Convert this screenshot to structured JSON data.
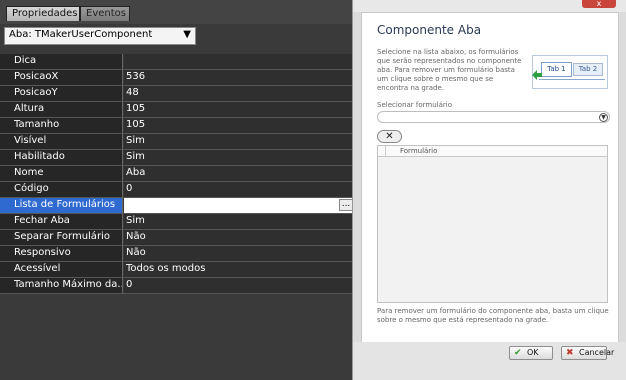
{
  "inspector": {
    "tabs": [
      "Propriedades",
      "Eventos"
    ],
    "component_selector": "Aba: TMakerUserComponent",
    "properties": [
      {
        "name": "Dica",
        "value": ""
      },
      {
        "name": "PosicaoX",
        "value": "536"
      },
      {
        "name": "PosicaoY",
        "value": "48"
      },
      {
        "name": "Altura",
        "value": "105"
      },
      {
        "name": "Tamanho",
        "value": "105"
      },
      {
        "name": "Visível",
        "value": "Sim"
      },
      {
        "name": "Habilitado",
        "value": "Sim"
      },
      {
        "name": "Nome",
        "value": "Aba"
      },
      {
        "name": "Código",
        "value": "0"
      },
      {
        "name": "Lista de Formulários",
        "value": ""
      },
      {
        "name": "Fechar Aba",
        "value": "Sim"
      },
      {
        "name": "Separar Formulário",
        "value": "Não"
      },
      {
        "name": "Responsivo",
        "value": "Não"
      },
      {
        "name": "Acessível",
        "value": "Todos os modos"
      },
      {
        "name": "Tamanho Máximo da...",
        "value": "0"
      }
    ],
    "selected_row_index": 9,
    "ellipsis_label": "..."
  },
  "dialog": {
    "close_label": "x",
    "title": "Componente Aba",
    "description": "Selecione na lista abaixo, os formulários que serão representados no componente aba. Para remover um formulário basta um clique sobre o mesmo que se encontra na grade.",
    "preview_tabs": [
      "Tab 1",
      "Tab 2"
    ],
    "select_label": "Selecionar formulário",
    "select_value": "",
    "remove_label": "✕",
    "grid_column": "Formulário",
    "footer_note": "Para remover um formulário do componente aba, basta um clique sobre o mesmo que está representado na grade.",
    "ok_label": "OK",
    "cancel_label": "Cancelar"
  },
  "colors": {
    "selected_row": "#2f6ad0",
    "close_button": "#c9463d",
    "ok_icon": "#2e9a2e",
    "cancel_icon": "#c0392b"
  }
}
